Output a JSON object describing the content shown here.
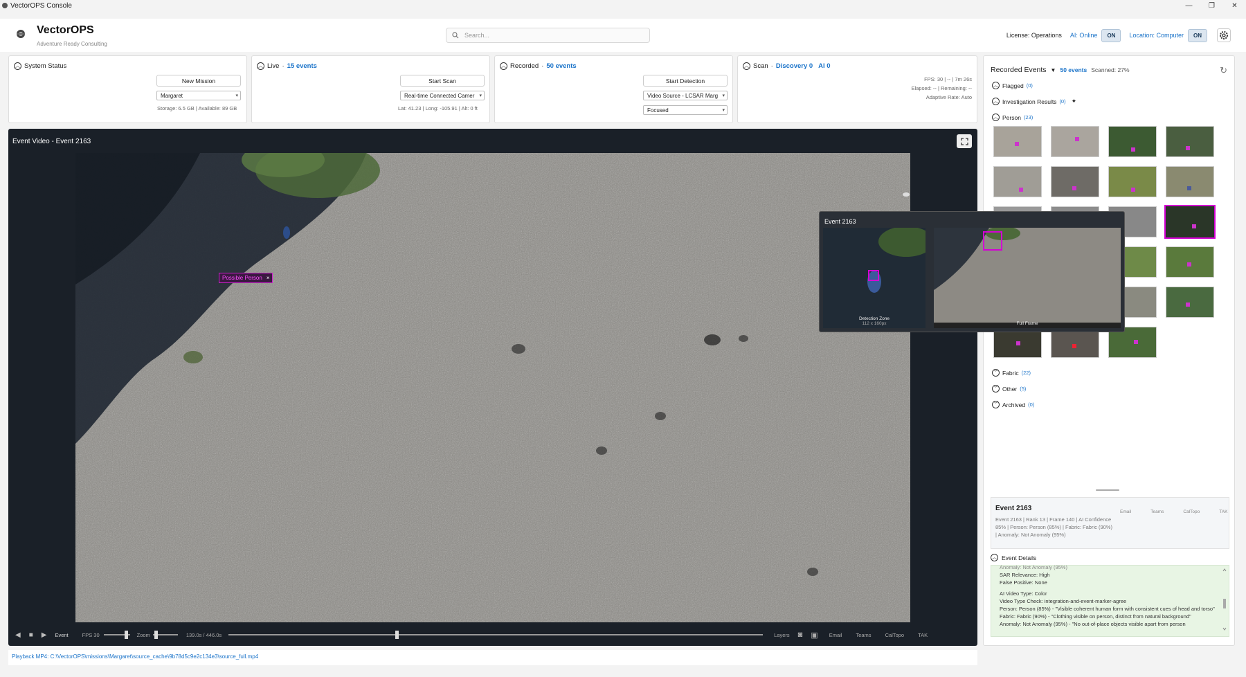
{
  "window": {
    "title": "VectorOPS Console"
  },
  "header": {
    "brand": "VectorOPS",
    "tagline": "Adventure Ready Consulting",
    "search_placeholder": "Search...",
    "license": "License: Operations",
    "ai_status": "AI: Online",
    "ai_toggle": "ON",
    "location": "Location: Computer",
    "location_toggle": "ON"
  },
  "panels": {
    "system": {
      "title": "System Status",
      "button": "New Mission",
      "mission": "Margaret",
      "storage": "Storage: 6.5 GB | Available: 89 GB"
    },
    "live": {
      "title": "Live",
      "count": "15 events",
      "button": "Start Scan",
      "source": "Real-time Connected Camer",
      "coords": "Lat: 41.23 | Long: -105.91 | Alt: 0 ft"
    },
    "recorded": {
      "title": "Recorded",
      "count": "50 events",
      "button": "Start Detection",
      "source": "Video Source - LCSAR Marg",
      "mode": "Focused"
    },
    "scan": {
      "title": "Scan",
      "discovery": "Discovery 0",
      "ai": "AI 0",
      "fps": "FPS: 30 | -- | 7m 26s",
      "elapsed": "Elapsed: -- | Remaining: --",
      "rate": "Adaptive Rate: Auto"
    }
  },
  "video": {
    "title": "Event Video - Event 2163",
    "detection_label": "Possible Person",
    "detection_close": "×",
    "controls": {
      "event": "Event",
      "fps": "FPS 30",
      "zoom": "Zoom",
      "time": "139.0s / 446.0s",
      "layers": "Layers",
      "email": "Email",
      "teams": "Teams",
      "caltopo": "CalTopo",
      "tak": "TAK"
    },
    "playback_progress": 0.312
  },
  "footer": {
    "path": "Playback MP4: C:\\VectorOPS\\missions\\Margaret\\source_cache\\9b78d5c9e2c134e3\\source_full.mp4"
  },
  "recorded_events": {
    "title": "Recorded Events",
    "count": "50 events",
    "scanned": "Scanned: 27%",
    "groups": [
      {
        "label": "Flagged",
        "count": "(0)"
      },
      {
        "label": "Investigation Results",
        "count": "(0)"
      },
      {
        "label": "Person",
        "count": "(23)"
      },
      {
        "label": "Fabric",
        "count": "(22)"
      },
      {
        "label": "Other",
        "count": "(5)"
      },
      {
        "label": "Archived",
        "count": "(0)"
      }
    ]
  },
  "popup": {
    "title": "Event 2163",
    "zone_label": "Detection Zone",
    "zone_sub": "112 x 160px",
    "frame_label": "Full Frame"
  },
  "event": {
    "title": "Event 2163",
    "summary": "Event 2163 | Rank 13 | Frame 140 | AI Confidence 85% | Person: Person (85%) | Fabric: Fabric (90%) | Anomaly: Not Anomaly (95%)",
    "actions": [
      "Email",
      "Teams",
      "CalTopo",
      "TAK"
    ],
    "details_title": "Event Details",
    "details": [
      "Anomaly: Not Anomaly (95%)",
      "SAR Relevance: High",
      "False Positive: None",
      "",
      "AI Video Type: Color",
      "Video Type Check: integration-and-event-marker-agree",
      "Person: Person (85%) - \"Visible coherent human form with consistent cues of head and torso\"",
      "Fabric: Fabric (90%) - \"Clothing visible on person, distinct from natural background\"",
      "Anomaly: Not Anomaly (95%) - \"No out-of-place objects visible apart from person"
    ]
  },
  "colors": {
    "accent": "#1a73c9",
    "highlight": "#d400d4",
    "video_bg": "#1a2028",
    "details_bg": "#e8f5e4"
  }
}
